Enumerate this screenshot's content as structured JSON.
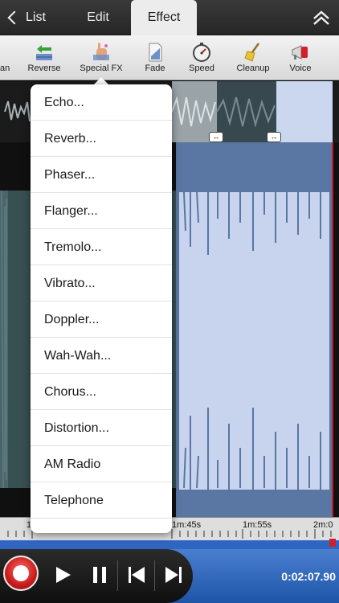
{
  "nav": {
    "back_label": "List",
    "tabs": [
      {
        "label": "Edit",
        "active": false
      },
      {
        "label": "Effect",
        "active": true
      }
    ],
    "collapse_icon": "double-chevron-up-icon"
  },
  "toolbar": {
    "tools": [
      {
        "label": "an",
        "icon": "pan-icon"
      },
      {
        "label": "Reverse",
        "icon": "reverse-arrows-icon"
      },
      {
        "label": "Special FX",
        "icon": "magic-hand-icon"
      },
      {
        "label": "Fade",
        "icon": "fade-document-icon"
      },
      {
        "label": "Speed",
        "icon": "stopwatch-icon"
      },
      {
        "label": "Cleanup",
        "icon": "broom-icon"
      },
      {
        "label": "Voice",
        "icon": "megaphone-icon"
      }
    ]
  },
  "fx_menu": {
    "items": [
      "Echo...",
      "Reverb...",
      "Phaser...",
      "Flanger...",
      "Tremolo...",
      "Vibrato...",
      "Doppler...",
      "Wah-Wah...",
      "Chorus...",
      "Distortion...",
      "AM Radio",
      "Telephone"
    ]
  },
  "timeline": {
    "labels": [
      "1",
      "1m:45s",
      "1m:55s",
      "2m:0"
    ]
  },
  "transport": {
    "time": "0:02:07.90",
    "buttons": [
      "record-icon",
      "play-icon",
      "pause-icon",
      "skip-to-start-icon",
      "skip-to-end-icon"
    ]
  },
  "colors": {
    "accent_blue": "#2f66c2",
    "selection": "#5b78a3",
    "record_red": "#d0202a"
  }
}
